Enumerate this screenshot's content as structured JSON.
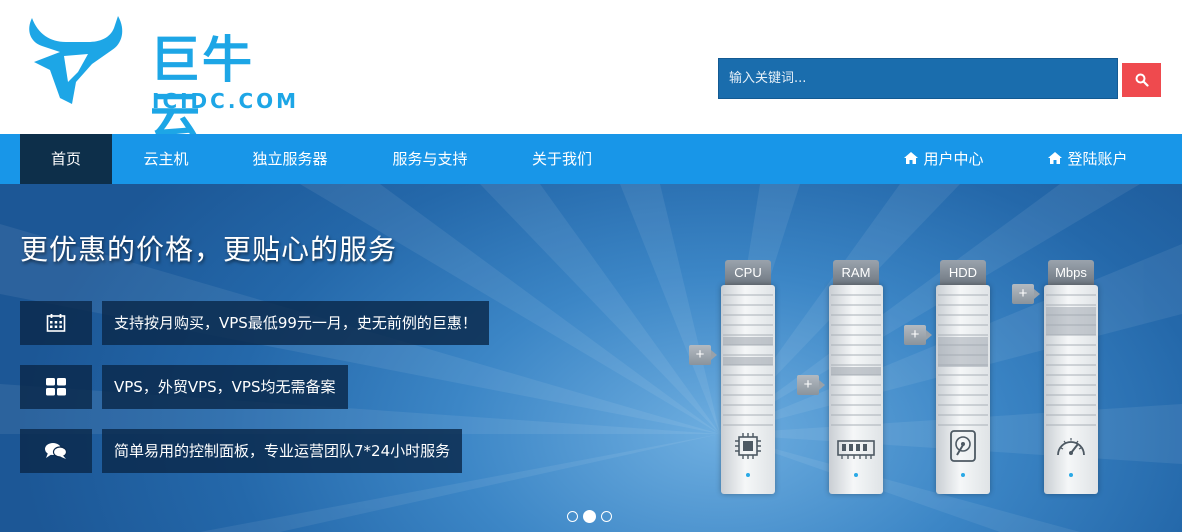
{
  "brand": {
    "name_cn": "巨牛云",
    "name_en": "ICIDC.COM",
    "color": "#1da6e6"
  },
  "search": {
    "placeholder": "输入关键词...",
    "button_icon": "search-icon",
    "button_color": "#ef4a4e"
  },
  "nav": {
    "items": [
      {
        "label": "首页",
        "active": true
      },
      {
        "label": "云主机"
      },
      {
        "label": "独立服务器"
      },
      {
        "label": "服务与支持"
      },
      {
        "label": "关于我们"
      }
    ],
    "right_items": [
      {
        "label": "用户中心",
        "icon": "home-icon"
      },
      {
        "label": "登陆账户",
        "icon": "home-icon"
      }
    ],
    "color": "#1896e8",
    "active_color": "#0d2f4a"
  },
  "banner": {
    "title": "更优惠的价格，更贴心的服务",
    "features": [
      {
        "icon": "calendar-icon",
        "text": "支持按月购买，VPS最低99元一月，史无前例的巨惠！"
      },
      {
        "icon": "grid-icon",
        "text": "VPS，外贸VPS，VPS均无需备案"
      },
      {
        "icon": "chat-icon",
        "text": "简单易用的控制面板，专业运营团队7*24小时服务"
      }
    ],
    "towers": [
      {
        "label": "CPU",
        "icon": "chip-icon"
      },
      {
        "label": "RAM",
        "icon": "memory-icon"
      },
      {
        "label": "HDD",
        "icon": "harddisk-icon"
      },
      {
        "label": "Mbps",
        "icon": "speedometer-icon"
      }
    ],
    "plus_symbol": "+",
    "slides": 3,
    "active_slide": 2
  }
}
